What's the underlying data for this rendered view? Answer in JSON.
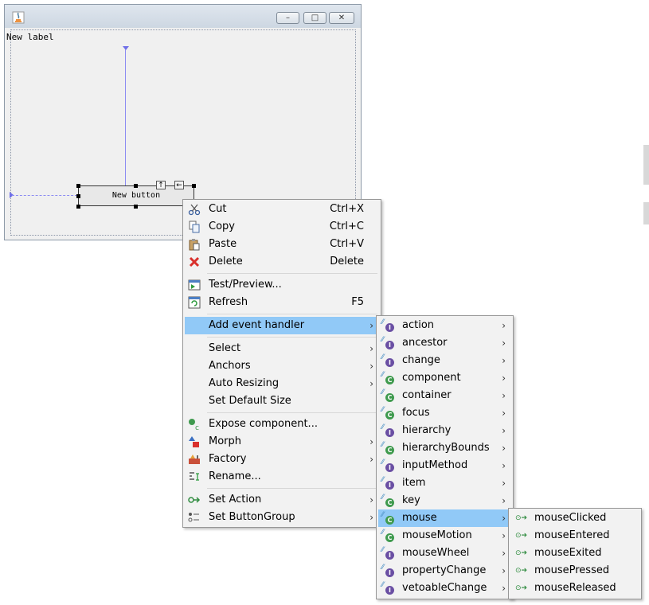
{
  "window": {
    "label_text": "New label",
    "button_text": "New button",
    "anchor_up": "↑",
    "anchor_left": "←",
    "minimize_glyph": "–",
    "maximize_glyph": "□",
    "close_glyph": "✕"
  },
  "context_menu": {
    "items": [
      {
        "label": "Cut",
        "shortcut": "Ctrl+X",
        "icon": "scissors-icon"
      },
      {
        "label": "Copy",
        "shortcut": "Ctrl+C",
        "icon": "copy-icon"
      },
      {
        "label": "Paste",
        "shortcut": "Ctrl+V",
        "icon": "paste-icon"
      },
      {
        "label": "Delete",
        "shortcut": "Delete",
        "icon": "delete-icon"
      },
      {
        "label": "Test/Preview...",
        "shortcut": "",
        "icon": "preview-icon"
      },
      {
        "label": "Refresh",
        "shortcut": "F5",
        "icon": "refresh-icon"
      },
      {
        "label": "Add event handler",
        "shortcut": "",
        "icon": ""
      },
      {
        "label": "Select",
        "shortcut": "",
        "icon": ""
      },
      {
        "label": "Anchors",
        "shortcut": "",
        "icon": ""
      },
      {
        "label": "Auto Resizing",
        "shortcut": "",
        "icon": ""
      },
      {
        "label": "Set Default Size",
        "shortcut": "",
        "icon": ""
      },
      {
        "label": "Expose component...",
        "shortcut": "",
        "icon": "expose-icon"
      },
      {
        "label": "Morph",
        "shortcut": "",
        "icon": "morph-icon"
      },
      {
        "label": "Factory",
        "shortcut": "",
        "icon": "factory-icon"
      },
      {
        "label": "Rename...",
        "shortcut": "",
        "icon": "rename-icon"
      },
      {
        "label": "Set Action",
        "shortcut": "",
        "icon": "action-icon"
      },
      {
        "label": "Set ButtonGroup",
        "shortcut": "",
        "icon": "buttongroup-icon"
      }
    ]
  },
  "event_menu": {
    "items": [
      {
        "label": "action",
        "kind": "I"
      },
      {
        "label": "ancestor",
        "kind": "I"
      },
      {
        "label": "change",
        "kind": "I"
      },
      {
        "label": "component",
        "kind": "C"
      },
      {
        "label": "container",
        "kind": "C"
      },
      {
        "label": "focus",
        "kind": "C"
      },
      {
        "label": "hierarchy",
        "kind": "I"
      },
      {
        "label": "hierarchyBounds",
        "kind": "C"
      },
      {
        "label": "inputMethod",
        "kind": "I"
      },
      {
        "label": "item",
        "kind": "I"
      },
      {
        "label": "key",
        "kind": "C"
      },
      {
        "label": "mouse",
        "kind": "C"
      },
      {
        "label": "mouseMotion",
        "kind": "C"
      },
      {
        "label": "mouseWheel",
        "kind": "I"
      },
      {
        "label": "propertyChange",
        "kind": "I"
      },
      {
        "label": "vetoableChange",
        "kind": "I"
      }
    ]
  },
  "mouse_menu": {
    "items": [
      {
        "label": "mouseClicked"
      },
      {
        "label": "mouseEntered"
      },
      {
        "label": "mouseExited"
      },
      {
        "label": "mousePressed"
      },
      {
        "label": "mouseReleased"
      }
    ]
  },
  "colors": {
    "highlight": "#91c9f7",
    "interface_badge": "#6a4fa3",
    "class_badge": "#3f9a4e"
  }
}
